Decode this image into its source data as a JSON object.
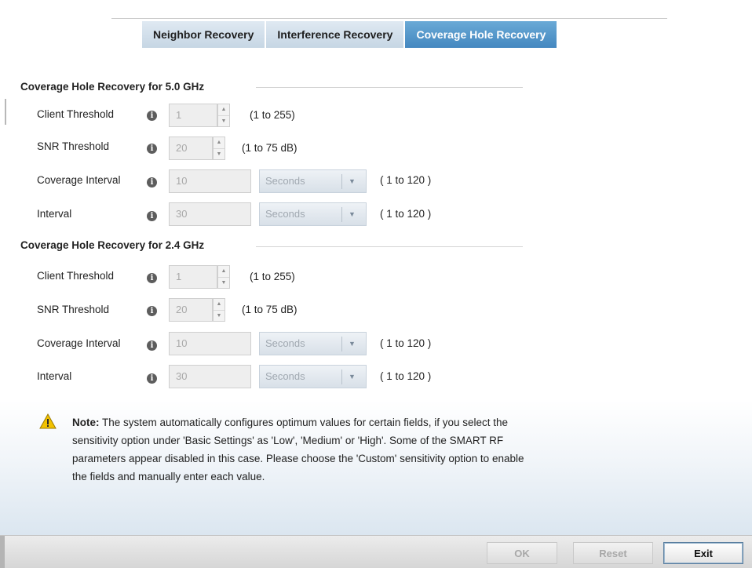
{
  "tabs": [
    {
      "label": "Neighbor Recovery",
      "active": false
    },
    {
      "label": "Interference Recovery",
      "active": false
    },
    {
      "label": "Coverage Hole Recovery",
      "active": true
    }
  ],
  "sections": [
    {
      "title": "Coverage Hole Recovery for 5.0 GHz",
      "client_threshold": {
        "label": "Client Threshold",
        "value": "1",
        "range": "(1 to 255)"
      },
      "snr_threshold": {
        "label": "SNR Threshold",
        "value": "20",
        "range": "(1 to 75 dB)"
      },
      "coverage_interval": {
        "label": "Coverage Interval",
        "value": "10",
        "unit": "Seconds",
        "range": "( 1 to 120 )"
      },
      "interval": {
        "label": "Interval",
        "value": "30",
        "unit": "Seconds",
        "range": "( 1 to 120 )"
      }
    },
    {
      "title": "Coverage Hole Recovery for 2.4 GHz",
      "client_threshold": {
        "label": "Client Threshold",
        "value": "1",
        "range": "(1 to 255)"
      },
      "snr_threshold": {
        "label": "SNR Threshold",
        "value": "20",
        "range": "(1 to 75 dB)"
      },
      "coverage_interval": {
        "label": "Coverage Interval",
        "value": "10",
        "unit": "Seconds",
        "range": "( 1 to 120 )"
      },
      "interval": {
        "label": "Interval",
        "value": "30",
        "unit": "Seconds",
        "range": "( 1 to 120 )"
      }
    }
  ],
  "info_glyph": "i",
  "spinner_up": "▲",
  "spinner_down": "▼",
  "select_arrow": "▼",
  "note": {
    "label": "Note:",
    "text": "The system automatically configures optimum values for certain fields, if you select the sensitivity option under 'Basic Settings' as 'Low', 'Medium' or 'High'. Some of the SMART RF parameters appear disabled in this case. Please choose the 'Custom' sensitivity option to enable the fields and manually enter each value.",
    "icon": "warning-triangle-icon"
  },
  "buttons": {
    "ok": "OK",
    "reset": "Reset",
    "exit": "Exit"
  },
  "colors": {
    "active_tab": "#4f93c9",
    "inactive_tab": "#d2dfea",
    "warning": "#f2c200"
  }
}
